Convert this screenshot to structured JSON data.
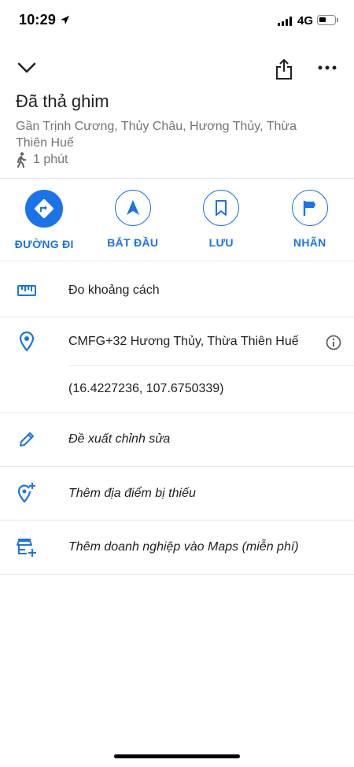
{
  "status_bar": {
    "time": "10:29",
    "network": "4G"
  },
  "place": {
    "title": "Đã thả ghim",
    "address": "Gần Trịnh Cương, Thủy Châu, Hương Thủy, Thừa Thiên Huế",
    "walk_time": "1 phút"
  },
  "actions": [
    {
      "label": "ĐƯỜNG ĐI",
      "icon": "directions-icon"
    },
    {
      "label": "BẮT ĐẦU",
      "icon": "navigation-arrow-icon"
    },
    {
      "label": "LƯU",
      "icon": "bookmark-icon"
    },
    {
      "label": "NHÃN",
      "icon": "flag-icon"
    }
  ],
  "rows": {
    "measure": "Đo khoảng cách",
    "plus_code": "CMFG+32 Hương Thủy, Thừa Thiên Huế",
    "coordinates": "(16.4227236, 107.6750339)",
    "suggest_edit": "Đề xuất chỉnh sửa",
    "add_missing_place": "Thêm địa điểm bị thiếu",
    "add_business": "Thêm doanh nghiệp vào Maps (miễn phí)"
  },
  "colors": {
    "accent": "#1a73e8",
    "text": "#202124",
    "secondary": "#70757a"
  }
}
